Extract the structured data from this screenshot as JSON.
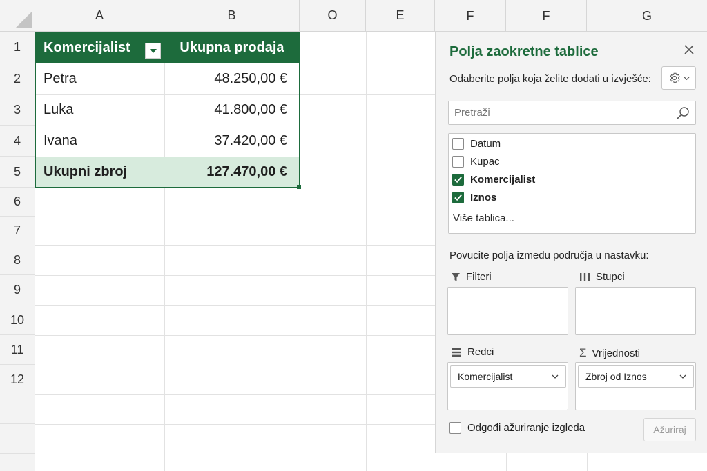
{
  "grid": {
    "columns": [
      "A",
      "B",
      "O",
      "E"
    ],
    "rows": [
      "1",
      "2",
      "3",
      "4",
      "5",
      "6",
      "7",
      "8",
      "9",
      "10",
      "11",
      "12"
    ],
    "pivot": {
      "header_name": "Komercijalist",
      "header_value": "Ukupna prodaja",
      "rows": [
        {
          "name": "Petra",
          "value": "48.250,00 €"
        },
        {
          "name": "Luka",
          "value": "41.800,00 €"
        },
        {
          "name": "Ivana",
          "value": "37.420,00 €"
        }
      ],
      "total": {
        "name": "Ukupni zbroj",
        "value": "127.470,00 €"
      }
    }
  },
  "top_strip": {
    "columns": [
      "F",
      "F",
      "G"
    ]
  },
  "panel": {
    "title": "Polja zaokretne tablice",
    "instruction": "Odaberite polja koja želite dodati u izvješće:",
    "search_placeholder": "Pretraži",
    "fields": [
      {
        "label": "Datum",
        "checked": false
      },
      {
        "label": "Kupac",
        "checked": false
      },
      {
        "label": "Komercijalist",
        "checked": true
      },
      {
        "label": "Iznos",
        "checked": true
      }
    ],
    "more_tables": "Više tablica...",
    "drag_instruction": "Povucite polja između područja u nastavku:",
    "areas": {
      "filters": {
        "label": "Filteri"
      },
      "columns": {
        "label": "Stupci"
      },
      "rows": {
        "label": "Redci",
        "item": "Komercijalist"
      },
      "values": {
        "label": "Vrijednosti",
        "item": "Zbroj od Iznos"
      }
    },
    "defer_label": "Odgođi ažuriranje izgleda",
    "update_button": "Ažuriraj"
  },
  "colors": {
    "accent": "#1d6b3c",
    "total_fill": "#d7ebdd",
    "panel_bg": "#f3f3f3"
  }
}
